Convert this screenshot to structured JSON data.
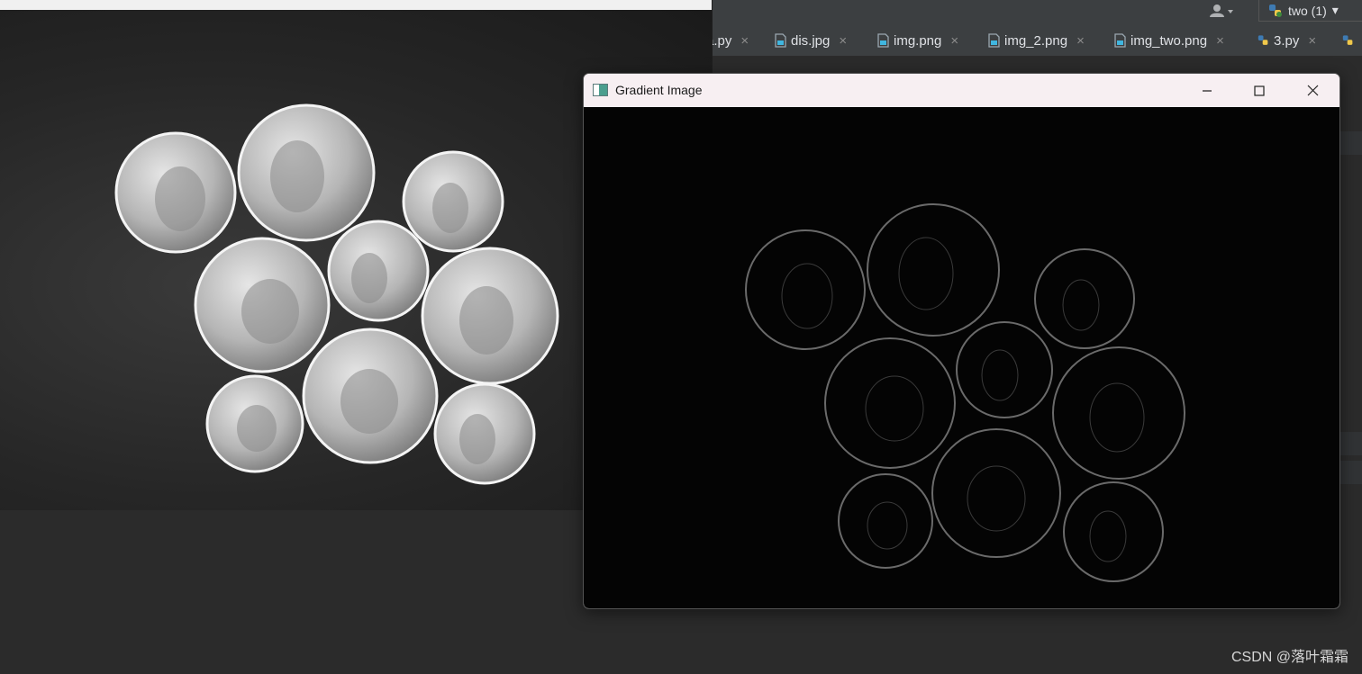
{
  "source_window": {
    "description_hidden": true
  },
  "ide": {
    "tabs": [
      {
        "label": "a.py",
        "icon": "python-file-icon"
      },
      {
        "label": "dis.jpg",
        "icon": "image-file-icon"
      },
      {
        "label": "img.png",
        "icon": "image-file-icon"
      },
      {
        "label": "img_2.png",
        "icon": "image-file-icon"
      },
      {
        "label": "img_two.png",
        "icon": "image-file-icon"
      },
      {
        "label": "3.py",
        "icon": "python-file-icon"
      }
    ],
    "tab_close_glyph": "×",
    "run_config": "two (1)",
    "run_config_arrow": "▾",
    "user_icon": "user-icon"
  },
  "gradient_window": {
    "title": "Gradient Image",
    "minimize_icon": "minimize-icon",
    "maximize_icon": "maximize-icon",
    "close_icon": "close-icon"
  },
  "watermark": "CSDN @落叶霜霜",
  "colors": {
    "ide_bg": "#2b2b2b",
    "titlebar": "#f7eff2",
    "gradient_bg": "#040404"
  }
}
